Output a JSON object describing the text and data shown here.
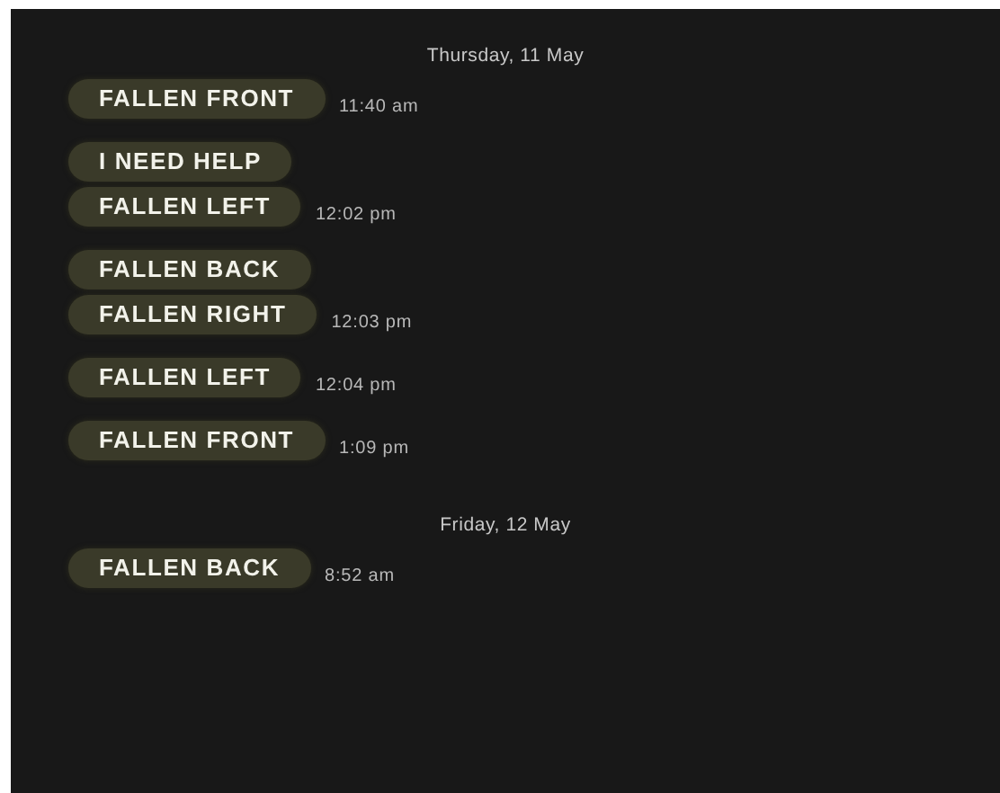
{
  "days": [
    {
      "date": "Thursday, 11 May",
      "messages": [
        {
          "text": "FALLEN FRONT",
          "time": "11:40 am"
        },
        {
          "text": "I NEED HELP"
        },
        {
          "text": "FALLEN LEFT",
          "time": "12:02 pm"
        },
        {
          "text": "FALLEN BACK"
        },
        {
          "text": "FALLEN RIGHT",
          "time": "12:03 pm"
        },
        {
          "text": "FALLEN LEFT",
          "time": "12:04 pm"
        },
        {
          "text": "FALLEN FRONT",
          "time": "1:09 pm"
        }
      ]
    },
    {
      "date": "Friday, 12 May",
      "messages": [
        {
          "text": "FALLEN BACK",
          "time": "8:52 am"
        }
      ]
    }
  ]
}
